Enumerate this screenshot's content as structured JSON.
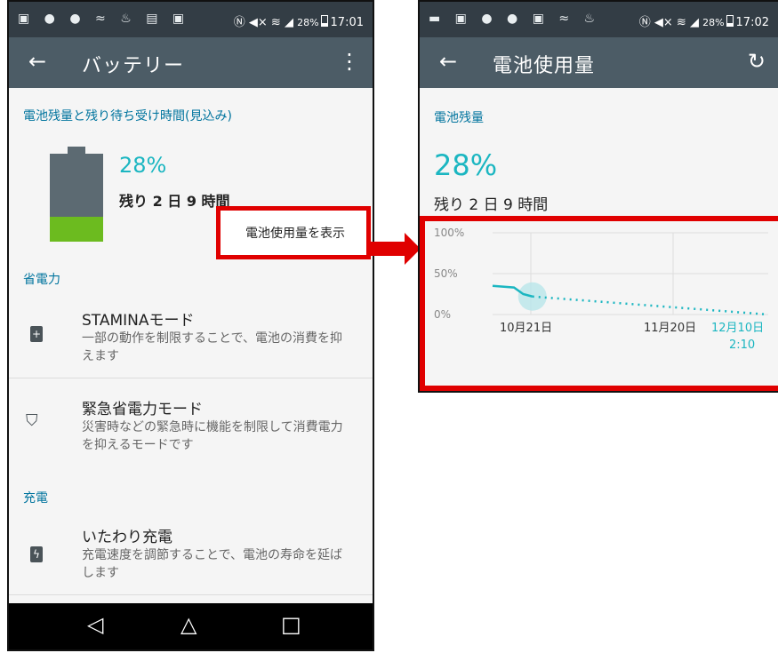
{
  "left_phone": {
    "statusbar": {
      "battery_pct": "28%",
      "time": "17:01"
    },
    "toolbar": {
      "title": "バッテリー"
    },
    "section_battery": "電池残量と残り待ち受け時間(見込み)",
    "battery": {
      "percent": "28%",
      "remaining": "残り 2 日 9 時間",
      "level": 0.28
    },
    "show_usage_link": "電池使用量を表示",
    "section_power_saving": "省電力",
    "items": [
      {
        "title": "STAMINAモード",
        "subtitle": "一部の動作を制限することで、電池の消費を抑えます"
      },
      {
        "title": "緊急省電力モード",
        "subtitle": "災害時などの緊急時に機能を制限して消費電力を抑えるモードです"
      }
    ],
    "section_charging": "充電",
    "charging_item": {
      "title": "いたわり充電",
      "subtitle": "充電速度を調節することで、電池の寿命を延ばします"
    },
    "navbar": {
      "back": "◁",
      "home": "△",
      "recents": "□"
    }
  },
  "right_phone": {
    "statusbar": {
      "battery_pct": "28%",
      "time": "17:02"
    },
    "toolbar": {
      "title": "電池使用量"
    },
    "section_battery": "電池残量",
    "battery": {
      "percent": "28%",
      "remaining": "残り 2 日 9 時間"
    }
  },
  "chart_data": {
    "type": "line",
    "y_tick_labels": [
      "100%",
      "50%",
      "0%"
    ],
    "x_tick_labels": [
      "10月21日",
      "11月20日"
    ],
    "current_label": [
      "12月10日",
      "2:10"
    ],
    "ylim": [
      0,
      100
    ],
    "series": [
      {
        "style": "solid",
        "points": [
          [
            0,
            35
          ],
          [
            0.7,
            33
          ],
          [
            1.0,
            25
          ],
          [
            1.3,
            22
          ]
        ]
      },
      {
        "style": "dotted-projection",
        "points": [
          [
            1.3,
            22
          ],
          [
            9.0,
            0
          ]
        ]
      }
    ],
    "colors": {
      "line": "#1bb6c1",
      "marker": "#b9e6ea"
    }
  },
  "colors": {
    "toolbar": "#4c5c66",
    "statusbar": "#333d45",
    "accent": "#1bb6c1",
    "section_header": "#00749e",
    "battery_body": "#5c6a72",
    "battery_fill": "#6cbb1f",
    "highlight": "#e00000"
  }
}
